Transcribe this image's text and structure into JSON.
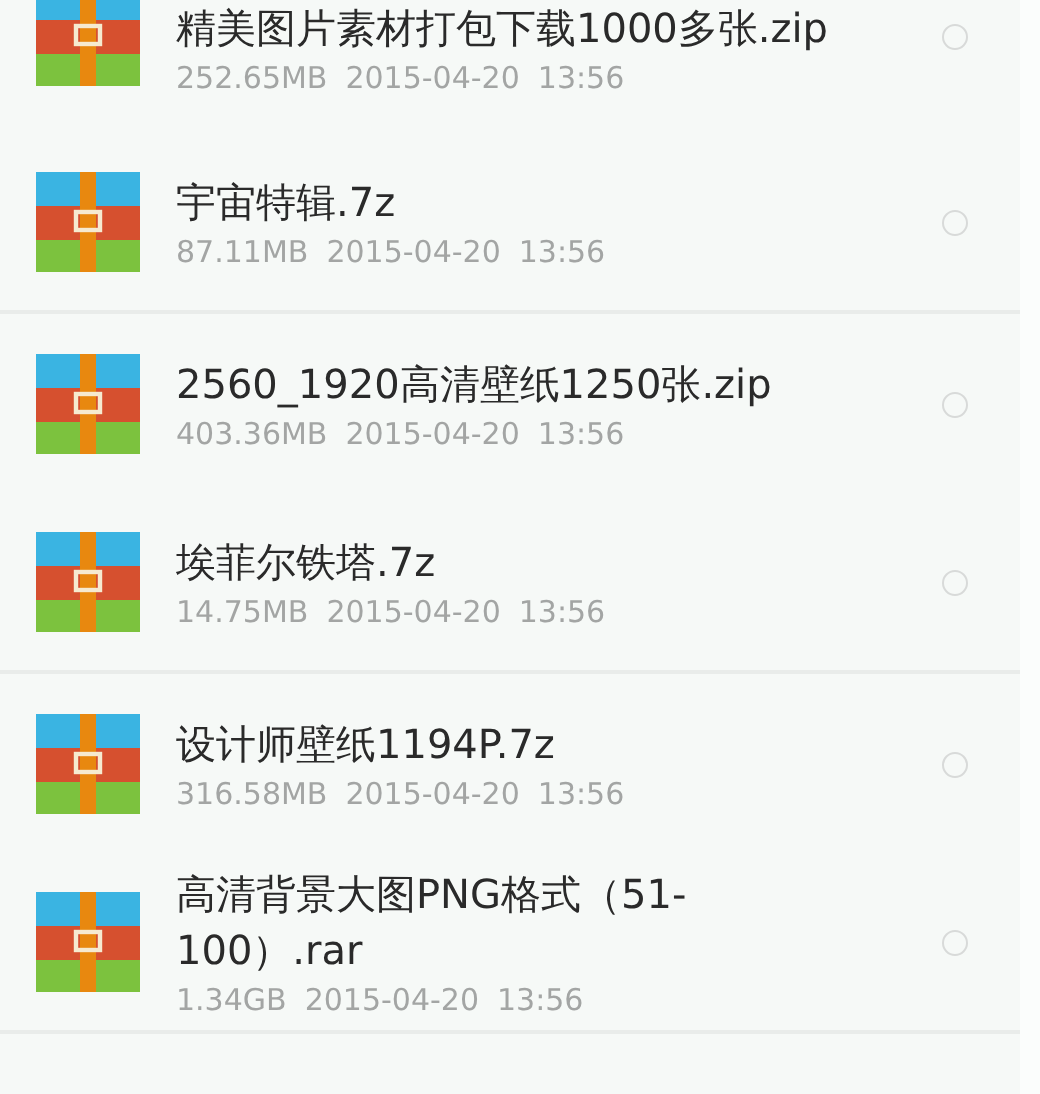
{
  "files": [
    {
      "name": "精美图片素材打包下载1000多张.zip",
      "size": "252.65MB",
      "date": "2015-04-20",
      "time": "13:56",
      "selected": false
    },
    {
      "name": "宇宙特辑.7z",
      "size": "87.11MB",
      "date": "2015-04-20",
      "time": "13:56",
      "selected": false
    },
    {
      "name": "2560_1920高清壁纸1250张.zip",
      "size": "403.36MB",
      "date": "2015-04-20",
      "time": "13:56",
      "selected": false
    },
    {
      "name": "埃菲尔铁塔.7z",
      "size": "14.75MB",
      "date": "2015-04-20",
      "time": "13:56",
      "selected": false
    },
    {
      "name": "设计师壁纸1194P.7z",
      "size": "316.58MB",
      "date": "2015-04-20",
      "time": "13:56",
      "selected": false
    },
    {
      "name": "高清背景大图PNG格式（51-100）.rar",
      "size": "1.34GB",
      "date": "2015-04-20",
      "time": "13:56",
      "selected": false
    }
  ]
}
